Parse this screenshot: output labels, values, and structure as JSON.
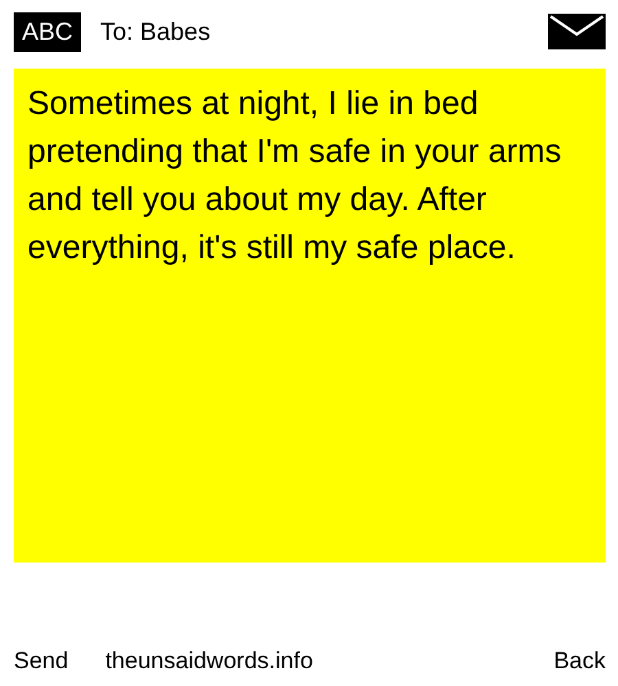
{
  "header": {
    "logo": "ABC",
    "recipient": "To: Babes"
  },
  "note": {
    "text": "Sometimes at night, I lie in bed pretending that I'm safe in your arms and tell you about my day. After everything, it's still my safe place."
  },
  "footer": {
    "left": "Send",
    "site": "theunsaidwords.info",
    "right": "Back"
  }
}
